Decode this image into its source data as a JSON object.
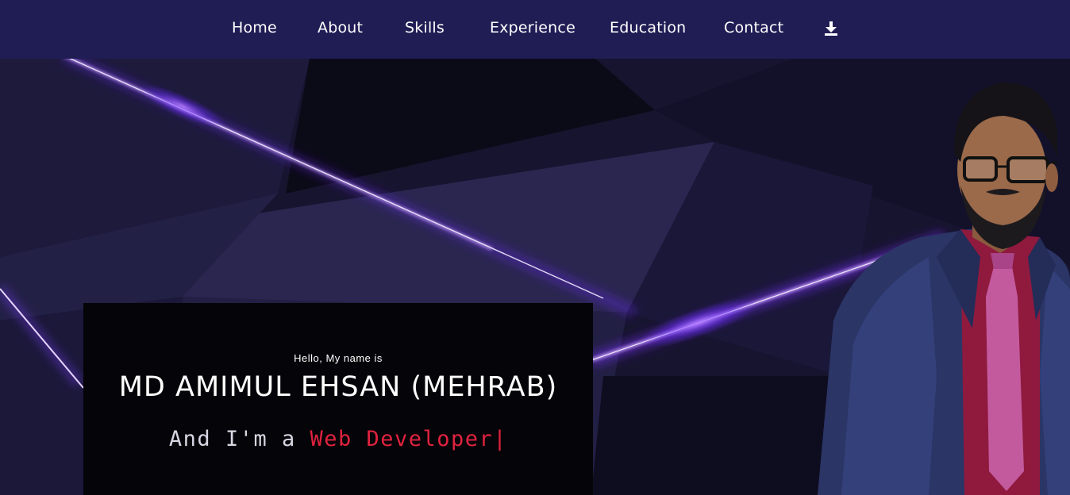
{
  "nav": {
    "items": [
      {
        "label": "Home"
      },
      {
        "label": "About"
      },
      {
        "label": "Skills"
      },
      {
        "label": "Experience"
      },
      {
        "label": "Education"
      },
      {
        "label": "Contact"
      }
    ],
    "download_icon": "download-icon"
  },
  "hero": {
    "greeting": "Hello, My name is",
    "name": "MD AMIMUL EHSAN (MEHRAB)",
    "role_prefix": "And I'm a ",
    "role_typed": "Web Developer",
    "cursor": "|"
  },
  "colors": {
    "nav_bg": "#201d55",
    "hero_bg": "#16132f",
    "accent_red": "#e0223f",
    "laser_purple": "#8a3dff"
  }
}
